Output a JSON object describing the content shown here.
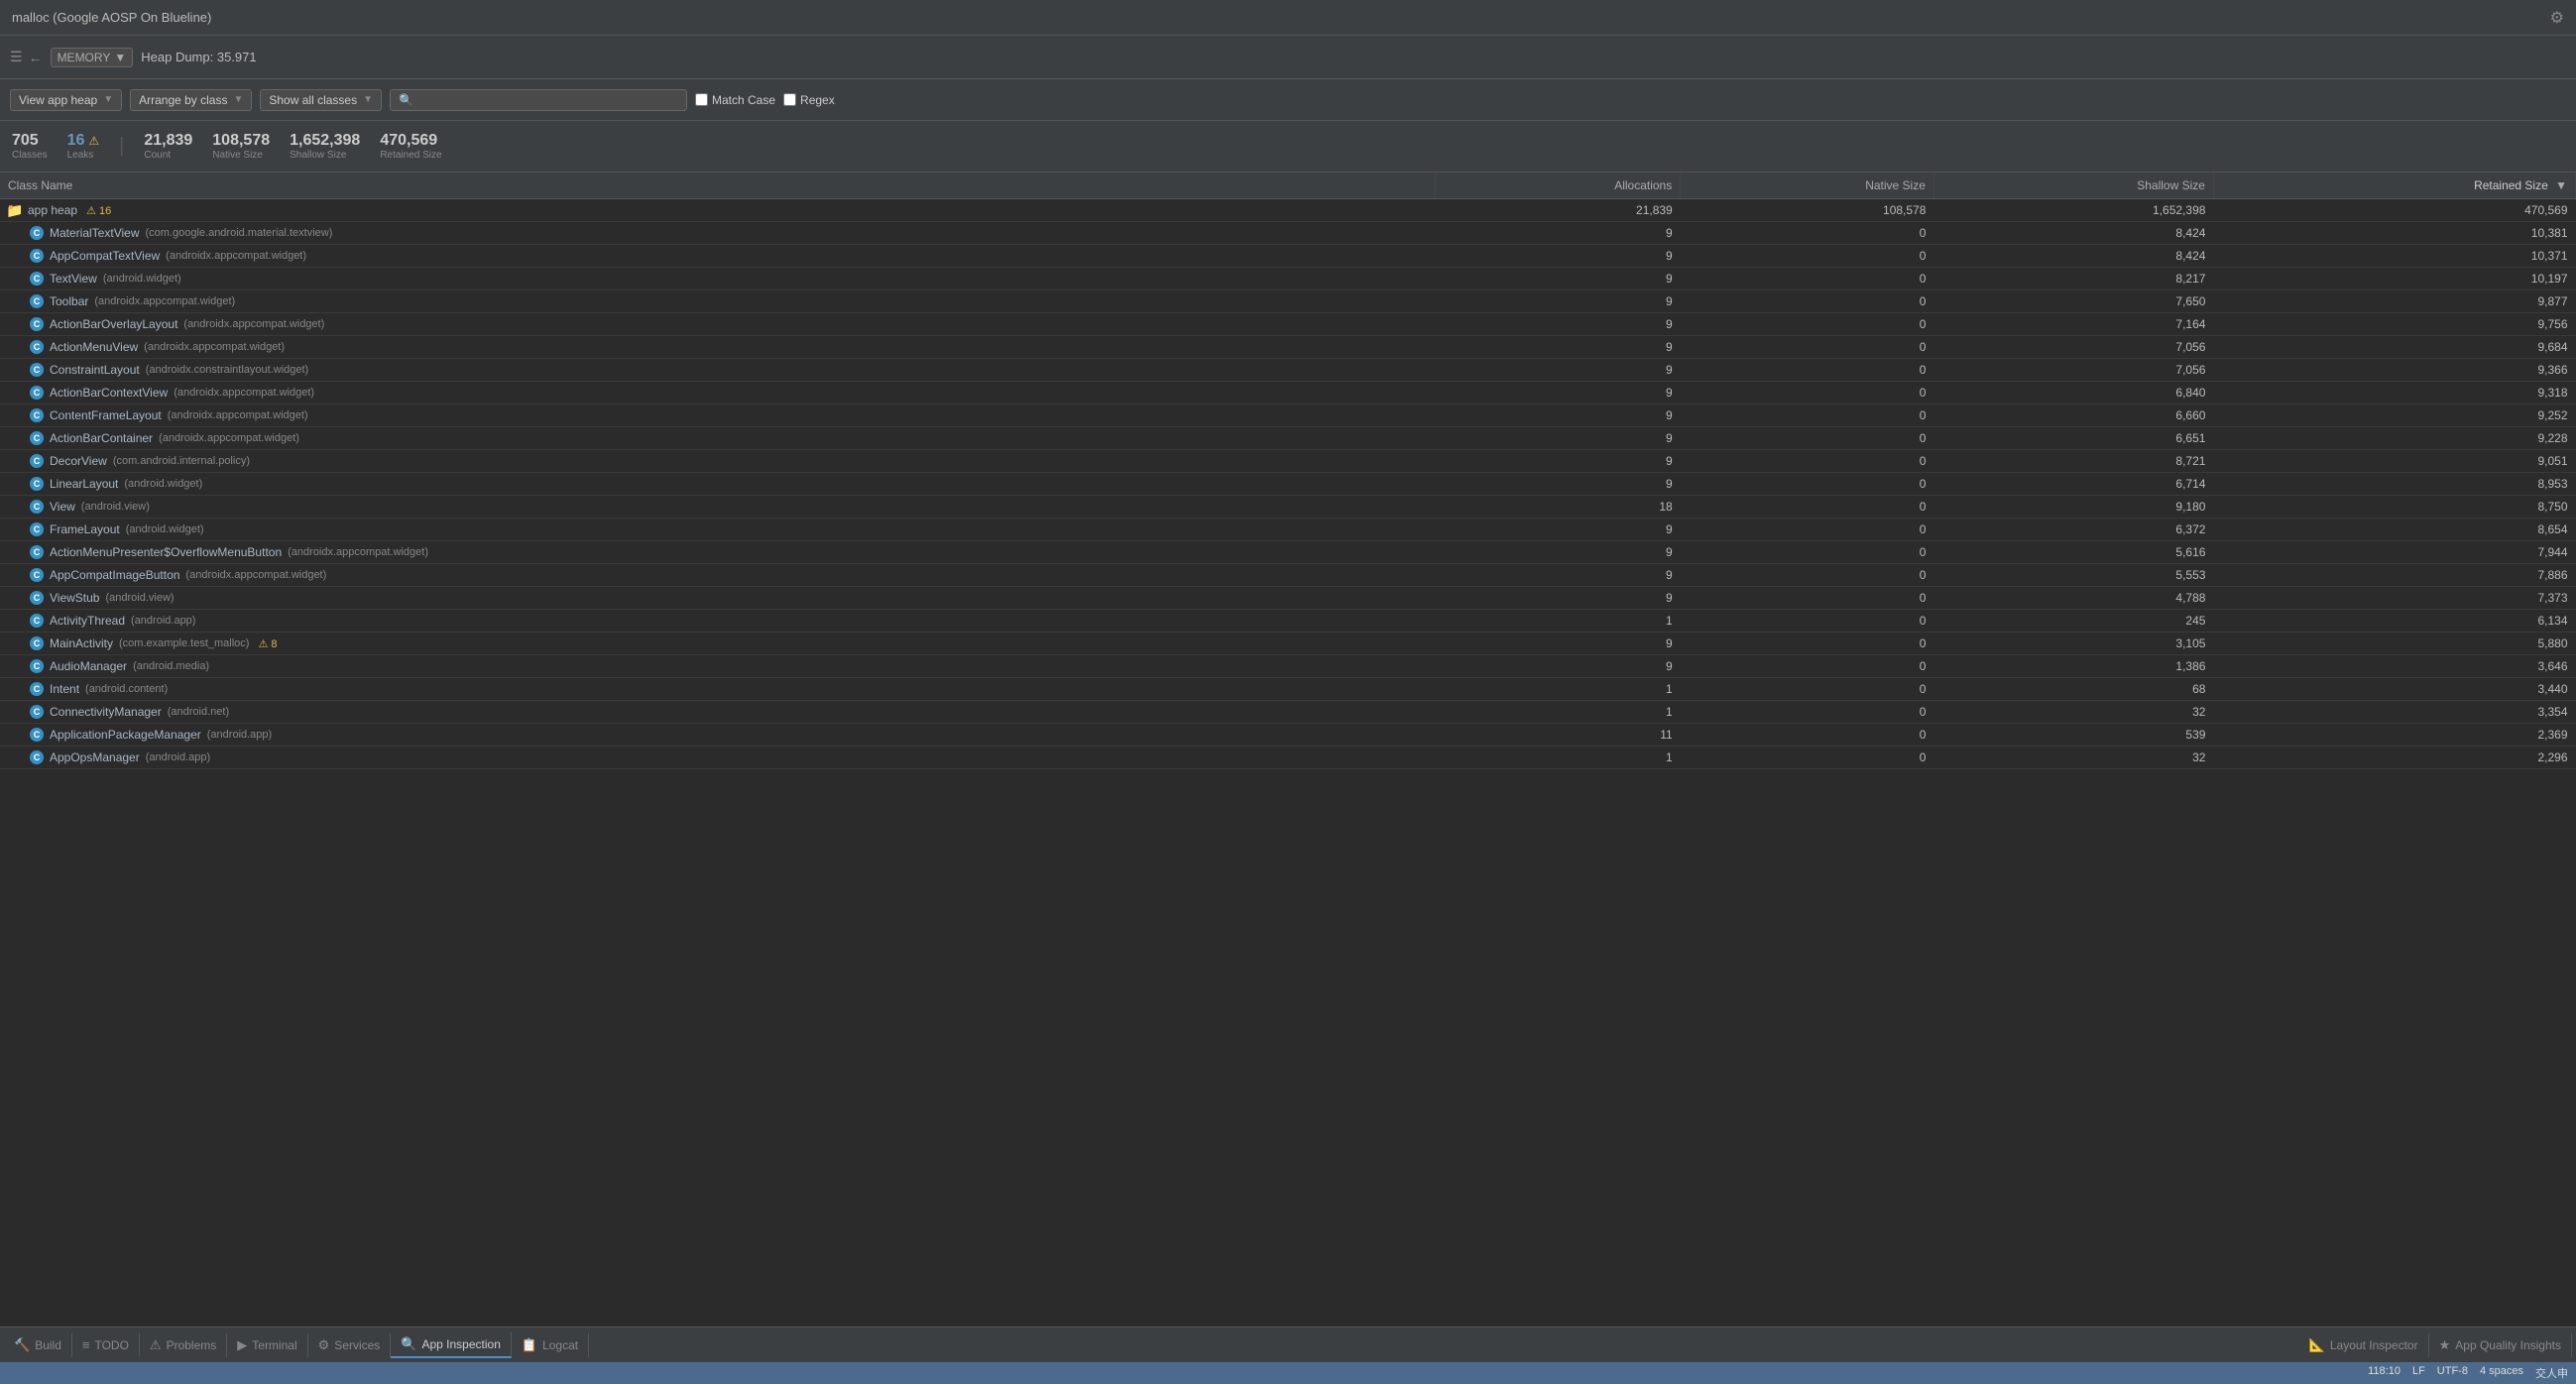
{
  "titleBar": {
    "title": "malloc (Google AOSP On Blueline)",
    "gearLabel": "⚙"
  },
  "toolbar": {
    "backIcon": "←",
    "memoryLabel": "MEMORY",
    "memoryArrow": "▼",
    "heapDumpLabel": "Heap Dump: 35.971"
  },
  "controls": {
    "viewAppHeap": "View app heap",
    "arrangeByClass": "Arrange by class",
    "showAllClasses": "Show all classes",
    "searchPlaceholder": "🔍",
    "matchCase": "Match Case",
    "regex": "Regex"
  },
  "stats": {
    "classes": "705",
    "classesLabel": "Classes",
    "leaks": "16",
    "leaksLabel": "Leaks",
    "count": "21,839",
    "countLabel": "Count",
    "nativeSize": "108,578",
    "nativeSizeLabel": "Native Size",
    "shallowSize": "1,652,398",
    "shallowSizeLabel": "Shallow Size",
    "retainedSize": "470,569",
    "retainedSizeLabel": "Retained Size"
  },
  "table": {
    "columns": [
      "Class Name",
      "Allocations",
      "Native Size",
      "Shallow Size",
      "Retained Size"
    ],
    "rows": [
      {
        "type": "folder",
        "name": "app heap",
        "package": "",
        "leaks": "16",
        "allocations": "21,839",
        "nativeSize": "108,578",
        "shallowSize": "1,652,398",
        "retainedSize": "470,569"
      },
      {
        "type": "class",
        "name": "MaterialTextView",
        "package": "(com.google.android.material.textview)",
        "leaks": "",
        "allocations": "9",
        "nativeSize": "0",
        "shallowSize": "8,424",
        "retainedSize": "10,381"
      },
      {
        "type": "class",
        "name": "AppCompatTextView",
        "package": "(androidx.appcompat.widget)",
        "leaks": "",
        "allocations": "9",
        "nativeSize": "0",
        "shallowSize": "8,424",
        "retainedSize": "10,371"
      },
      {
        "type": "class",
        "name": "TextView",
        "package": "(android.widget)",
        "leaks": "",
        "allocations": "9",
        "nativeSize": "0",
        "shallowSize": "8,217",
        "retainedSize": "10,197"
      },
      {
        "type": "class",
        "name": "Toolbar",
        "package": "(androidx.appcompat.widget)",
        "leaks": "",
        "allocations": "9",
        "nativeSize": "0",
        "shallowSize": "7,650",
        "retainedSize": "9,877"
      },
      {
        "type": "class",
        "name": "ActionBarOverlayLayout",
        "package": "(androidx.appcompat.widget)",
        "leaks": "",
        "allocations": "9",
        "nativeSize": "0",
        "shallowSize": "7,164",
        "retainedSize": "9,756"
      },
      {
        "type": "class",
        "name": "ActionMenuView",
        "package": "(androidx.appcompat.widget)",
        "leaks": "",
        "allocations": "9",
        "nativeSize": "0",
        "shallowSize": "7,056",
        "retainedSize": "9,684"
      },
      {
        "type": "class",
        "name": "ConstraintLayout",
        "package": "(androidx.constraintlayout.widget)",
        "leaks": "",
        "allocations": "9",
        "nativeSize": "0",
        "shallowSize": "7,056",
        "retainedSize": "9,366"
      },
      {
        "type": "class",
        "name": "ActionBarContextView",
        "package": "(androidx.appcompat.widget)",
        "leaks": "",
        "allocations": "9",
        "nativeSize": "0",
        "shallowSize": "6,840",
        "retainedSize": "9,318"
      },
      {
        "type": "class",
        "name": "ContentFrameLayout",
        "package": "(androidx.appcompat.widget)",
        "leaks": "",
        "allocations": "9",
        "nativeSize": "0",
        "shallowSize": "6,660",
        "retainedSize": "9,252"
      },
      {
        "type": "class",
        "name": "ActionBarContainer",
        "package": "(androidx.appcompat.widget)",
        "leaks": "",
        "allocations": "9",
        "nativeSize": "0",
        "shallowSize": "6,651",
        "retainedSize": "9,228"
      },
      {
        "type": "class",
        "name": "DecorView",
        "package": "(com.android.internal.policy)",
        "leaks": "",
        "allocations": "9",
        "nativeSize": "0",
        "shallowSize": "8,721",
        "retainedSize": "9,051"
      },
      {
        "type": "class",
        "name": "LinearLayout",
        "package": "(android.widget)",
        "leaks": "",
        "allocations": "9",
        "nativeSize": "0",
        "shallowSize": "6,714",
        "retainedSize": "8,953"
      },
      {
        "type": "class",
        "name": "View",
        "package": "(android.view)",
        "leaks": "",
        "allocations": "18",
        "nativeSize": "0",
        "shallowSize": "9,180",
        "retainedSize": "8,750"
      },
      {
        "type": "class",
        "name": "FrameLayout",
        "package": "(android.widget)",
        "leaks": "",
        "allocations": "9",
        "nativeSize": "0",
        "shallowSize": "6,372",
        "retainedSize": "8,654"
      },
      {
        "type": "class",
        "name": "ActionMenuPresenter$OverflowMenuButton",
        "package": "(androidx.appcompat.widget)",
        "leaks": "",
        "allocations": "9",
        "nativeSize": "0",
        "shallowSize": "5,616",
        "retainedSize": "7,944"
      },
      {
        "type": "class",
        "name": "AppCompatImageButton",
        "package": "(androidx.appcompat.widget)",
        "leaks": "",
        "allocations": "9",
        "nativeSize": "0",
        "shallowSize": "5,553",
        "retainedSize": "7,886"
      },
      {
        "type": "class",
        "name": "ViewStub",
        "package": "(android.view)",
        "leaks": "",
        "allocations": "9",
        "nativeSize": "0",
        "shallowSize": "4,788",
        "retainedSize": "7,373"
      },
      {
        "type": "class",
        "name": "ActivityThread",
        "package": "(android.app)",
        "leaks": "",
        "allocations": "1",
        "nativeSize": "0",
        "shallowSize": "245",
        "retainedSize": "6,134"
      },
      {
        "type": "class",
        "name": "MainActivity",
        "package": "(com.example.test_malloc)",
        "leaks": "8",
        "allocations": "9",
        "nativeSize": "0",
        "shallowSize": "3,105",
        "retainedSize": "5,880"
      },
      {
        "type": "class",
        "name": "AudioManager",
        "package": "(android.media)",
        "leaks": "",
        "allocations": "9",
        "nativeSize": "0",
        "shallowSize": "1,386",
        "retainedSize": "3,646"
      },
      {
        "type": "class",
        "name": "Intent",
        "package": "(android.content)",
        "leaks": "",
        "allocations": "1",
        "nativeSize": "0",
        "shallowSize": "68",
        "retainedSize": "3,440"
      },
      {
        "type": "class",
        "name": "ConnectivityManager",
        "package": "(android.net)",
        "leaks": "",
        "allocations": "1",
        "nativeSize": "0",
        "shallowSize": "32",
        "retainedSize": "3,354"
      },
      {
        "type": "class",
        "name": "ApplicationPackageManager",
        "package": "(android.app)",
        "leaks": "",
        "allocations": "11",
        "nativeSize": "0",
        "shallowSize": "539",
        "retainedSize": "2,369"
      },
      {
        "type": "class",
        "name": "AppOpsManager",
        "package": "(android.app)",
        "leaks": "",
        "allocations": "1",
        "nativeSize": "0",
        "shallowSize": "32",
        "retainedSize": "2,296"
      }
    ]
  },
  "bottomTabs": [
    {
      "icon": "🔨",
      "label": "Build"
    },
    {
      "icon": "≡",
      "label": "TODO"
    },
    {
      "icon": "⚠",
      "label": "Problems"
    },
    {
      "icon": "▶",
      "label": "Terminal"
    },
    {
      "icon": "⚙",
      "label": "Services"
    },
    {
      "icon": "🔍",
      "label": "App Inspection"
    },
    {
      "icon": "📋",
      "label": "Logcat"
    },
    {
      "icon": "📐",
      "label": "Layout Inspector"
    },
    {
      "icon": "★",
      "label": "App Quality Insights"
    }
  ],
  "statusBar": {
    "position": "118:10",
    "encoding": "LF",
    "charset": "UTF-8",
    "indent": "4 spaces",
    "extra": "交人申"
  }
}
